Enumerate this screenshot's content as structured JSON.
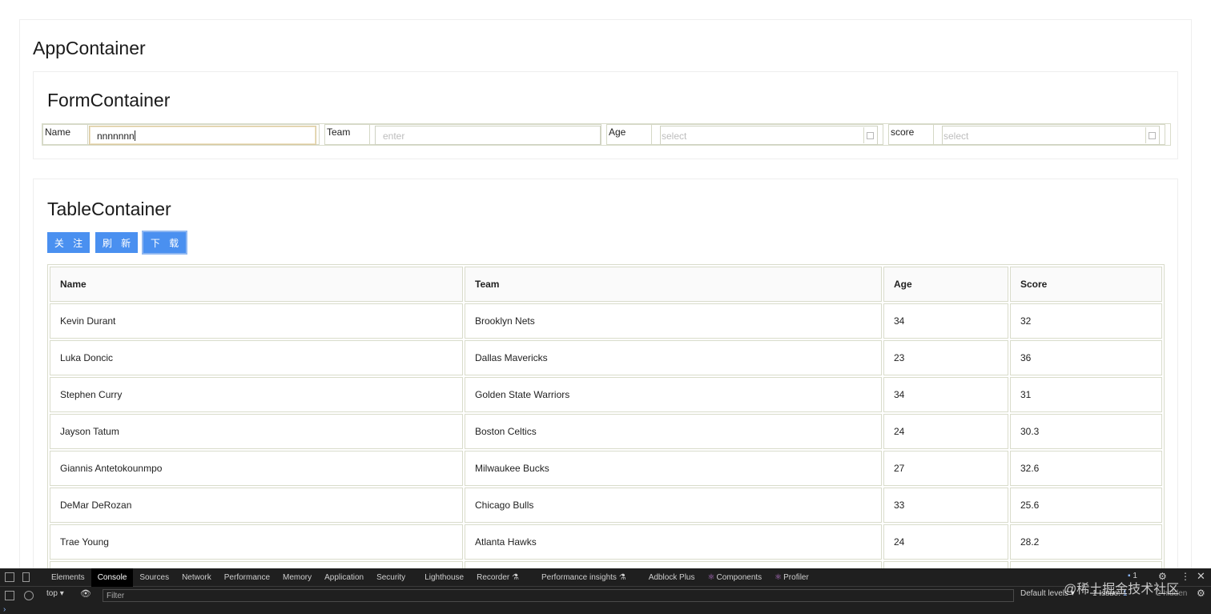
{
  "app": {
    "title": "AppContainer"
  },
  "form": {
    "title": "FormContainer",
    "fields": [
      {
        "label": "Name",
        "value": "nnnnnnn",
        "placeholder": ""
      },
      {
        "label": "Team",
        "value": "",
        "placeholder": "enter"
      },
      {
        "label": "Age",
        "value": "",
        "placeholder": "select"
      },
      {
        "label": "score",
        "value": "",
        "placeholder": "select"
      }
    ]
  },
  "table_section": {
    "title": "TableContainer",
    "buttons": [
      "关 注",
      "刷 新",
      "下 载"
    ],
    "columns": [
      "Name",
      "Team",
      "Age",
      "Score"
    ],
    "rows": [
      [
        "Kevin Durant",
        "Brooklyn Nets",
        "34",
        "32"
      ],
      [
        "Luka Doncic",
        "Dallas Mavericks",
        "23",
        "36"
      ],
      [
        "Stephen Curry",
        "Golden State Warriors",
        "34",
        "31"
      ],
      [
        "Jayson Tatum",
        "Boston Celtics",
        "24",
        "30.3"
      ],
      [
        "Giannis Antetokounmpo",
        "Milwaukee Bucks",
        "27",
        "32.6"
      ],
      [
        "DeMar DeRozan",
        "Chicago Bulls",
        "33",
        "25.6"
      ],
      [
        "Trae Young",
        "Atlanta Hawks",
        "24",
        "28.2"
      ]
    ]
  },
  "devtools": {
    "tabs": [
      "Elements",
      "Console",
      "Sources",
      "Network",
      "Performance",
      "Memory",
      "Application",
      "Security",
      "Lighthouse",
      "Recorder ⚗",
      "Performance insights ⚗",
      "Adblock Plus",
      "Components",
      "Profiler"
    ],
    "active_tab": "Console",
    "context": "top",
    "filter_placeholder": "Filter",
    "levels": "Default levels",
    "issues": "1 Issue:",
    "issue_count": "1",
    "hidden": "2 hidden",
    "badge_count": "1"
  },
  "watermark": "@稀土掘金技术社区"
}
